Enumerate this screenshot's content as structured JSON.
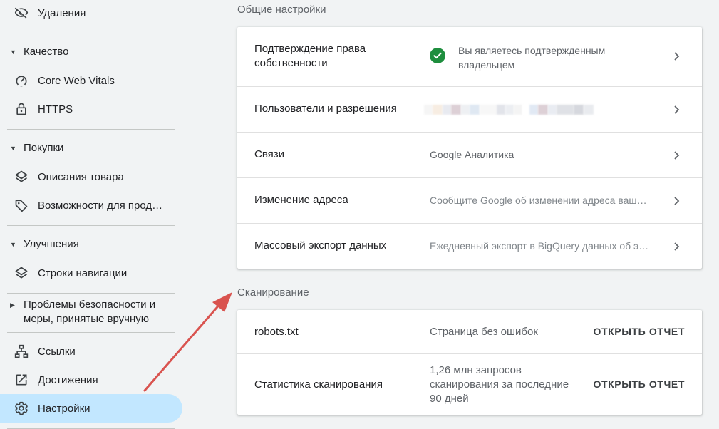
{
  "sidebar": {
    "removals": "Удаления",
    "quality": {
      "title": "Качество",
      "items": [
        "Core Web Vitals",
        "HTTPS"
      ]
    },
    "shopping": {
      "title": "Покупки",
      "items": [
        "Описания товара",
        "Возможности для прод…"
      ]
    },
    "enhancements": {
      "title": "Улучшения",
      "items": [
        "Строки навигации"
      ]
    },
    "security": {
      "title": "Проблемы безопасности и меры, принятые вручную"
    },
    "links": "Ссылки",
    "achievements": "Достижения",
    "settings": "Настройки"
  },
  "general": {
    "title": "Общие настройки",
    "rows": [
      {
        "label": "Подтверждение права собственности",
        "value": "Вы являетесь подтвержденным владельцем"
      },
      {
        "label": "Пользователи и разрешения",
        "value": ""
      },
      {
        "label": "Связи",
        "value": "Google Аналитика"
      },
      {
        "label": "Изменение адреса",
        "value": "Сообщите Google об изменении адреса вашего сайта"
      },
      {
        "label": "Массовый экспорт данных",
        "value": "Ежедневный экспорт в BigQuery данных об эффективности"
      }
    ]
  },
  "crawl": {
    "title": "Сканирование",
    "rows": [
      {
        "label": "robots.txt",
        "value": "Страница без ошибок",
        "action": "ОТКРЫТЬ ОТЧЕТ"
      },
      {
        "label": "Статистика сканирования",
        "value": "1,26 млн запросов сканирования за последние 90 дней",
        "action": "ОТКРЫТЬ ОТЧЕТ"
      }
    ]
  },
  "colors": {
    "active_bg": "#c2e7ff",
    "check_green": "#1e8e3e",
    "annotation_arrow": "#d9534f"
  }
}
